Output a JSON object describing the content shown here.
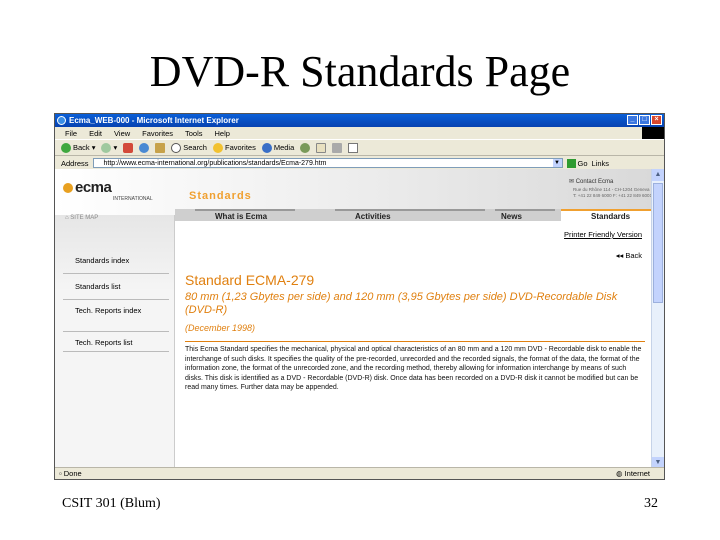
{
  "slide": {
    "title": "DVD-R Standards Page",
    "footer_left": "CSIT 301 (Blum)",
    "footer_right": "32"
  },
  "window": {
    "title": "Ecma_WEB-000 - Microsoft Internet Explorer",
    "controls": [
      "_",
      "□",
      "×"
    ],
    "menu": [
      "File",
      "Edit",
      "View",
      "Favorites",
      "Tools",
      "Help"
    ],
    "toolbar": {
      "back": "Back",
      "search": "Search",
      "favorites": "Favorites",
      "media": "Media"
    },
    "address_label": "Address",
    "address_value": "http://www.ecma-international.org/publications/standards/Ecma-279.htm",
    "go": "Go",
    "links": "Links",
    "status": "Done",
    "zone": "Internet"
  },
  "page": {
    "logo": "ecma",
    "logo_sub": "INTERNATIONAL",
    "section_title": "Standards",
    "contact": "Contact Ecma",
    "contact_addr": "Rue du Rhône 114 - CH-1204 Geneva T: +41 22 849 6000 F: +41 22 849 6001",
    "sitemap": "SITE MAP",
    "nav": [
      "What is Ecma",
      "Activities",
      "News",
      "Standards"
    ],
    "sidebar": [
      "Standards index",
      "Standards list",
      "Tech. Reports index",
      "Tech. Reports list"
    ],
    "printer_friendly": "Printer Friendly Version",
    "back": "Back",
    "std_title": "Standard ECMA-279",
    "std_subtitle": "80 mm (1,23 Gbytes per side) and 120 mm (3,95 Gbytes per side) DVD-Recordable Disk (DVD-R)",
    "std_date": "(December 1998)",
    "description": "This Ecma Standard specifies the mechanical, physical and optical characteristics of an 80 mm and a 120 mm DVD - Recordable disk to enable the interchange of such disks. It specifies the quality of the pre-recorded, unrecorded and the recorded signals, the format of the data, the format of the information zone, the format of the unrecorded zone, and the recording method, thereby allowing for information interchange by means of such disks. This disk is identified as a DVD - Recordable (DVD-R) disk. Once data has been recorded on a DVD-R disk it cannot be modified but can be read many times. Further data may be appended."
  }
}
